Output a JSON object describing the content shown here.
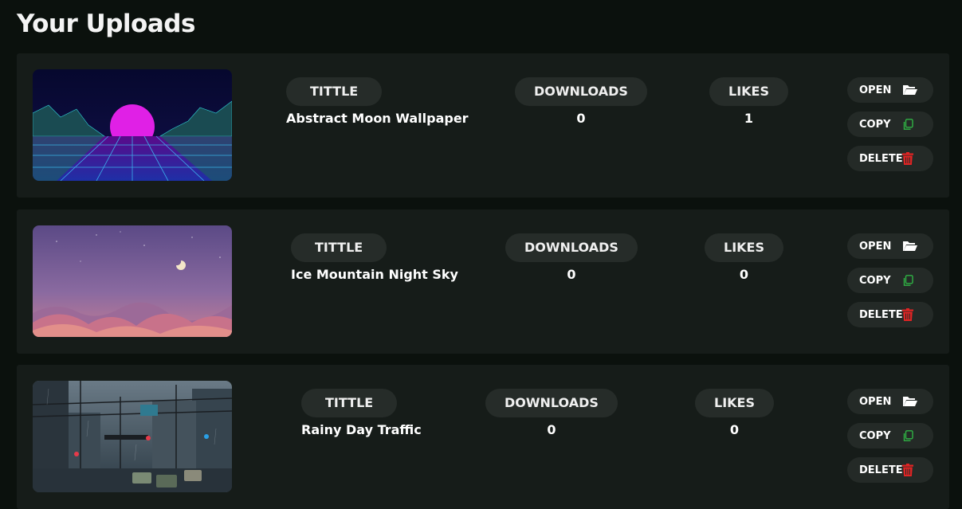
{
  "page": {
    "title": "Your Uploads"
  },
  "labels": {
    "title": "TITTLE",
    "downloads": "DOWNLOADS",
    "likes": "LIKES"
  },
  "actions": {
    "open": "OPEN",
    "copy": "COPY",
    "delete": "DELETE"
  },
  "colors": {
    "accent_green": "#2fb344",
    "accent_red": "#e02424",
    "card_bg": "#161c19",
    "pill_bg": "#262c29"
  },
  "icons": {
    "open": "folder-open-icon",
    "copy": "copy-icon",
    "delete": "trash-icon"
  },
  "uploads": [
    {
      "title": "Abstract Moon Wallpaper",
      "downloads": "0",
      "likes": "1"
    },
    {
      "title": "Ice Mountain Night Sky",
      "downloads": "0",
      "likes": "0"
    },
    {
      "title": "Rainy Day Traffic",
      "downloads": "0",
      "likes": "0"
    }
  ]
}
